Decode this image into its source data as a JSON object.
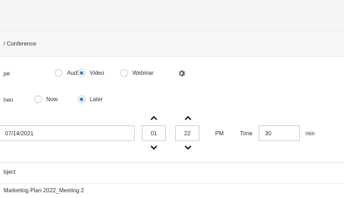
{
  "header": {
    "section_title": "/ Conference"
  },
  "type_row": {
    "label": "pe",
    "options": [
      {
        "label": "Audio",
        "checked": false
      },
      {
        "label": "Video",
        "checked": true
      },
      {
        "label": "Webinar",
        "checked": false
      }
    ],
    "settings_icon": "gear-icon"
  },
  "when_row": {
    "label": "hen",
    "options": [
      {
        "label": "Now",
        "checked": false
      },
      {
        "label": "Later",
        "checked": true
      }
    ]
  },
  "datetime": {
    "date": "07/14/2021",
    "hour": "01",
    "minute": "22",
    "ampm": "PM",
    "time_label": "Time",
    "duration": "30",
    "duration_unit": "min"
  },
  "subject": {
    "label": "bject",
    "value": "Marketing Plan 2022_Meeting 2"
  },
  "colors": {
    "accent": "#1e88e5",
    "border": "#cfcfcf"
  }
}
